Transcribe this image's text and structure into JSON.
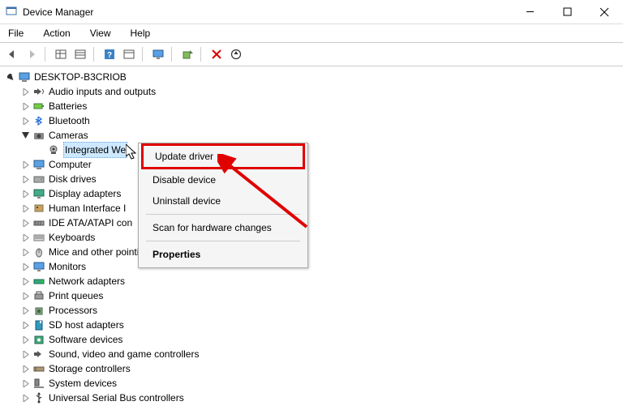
{
  "window": {
    "title": "Device Manager"
  },
  "menu": {
    "file": "File",
    "action": "Action",
    "view": "View",
    "help": "Help"
  },
  "tree": {
    "root": "DESKTOP-B3CRIOB",
    "items": [
      "Audio inputs and outputs",
      "Batteries",
      "Bluetooth",
      "Cameras",
      "Computer",
      "Disk drives",
      "Display adapters",
      "Human Interface I",
      "IDE ATA/ATAPI con",
      "Keyboards",
      "Mice and other pointing devices",
      "Monitors",
      "Network adapters",
      "Print queues",
      "Processors",
      "SD host adapters",
      "Software devices",
      "Sound, video and game controllers",
      "Storage controllers",
      "System devices",
      "Universal Serial Bus controllers"
    ],
    "camera_child": "Integrated We"
  },
  "contextMenu": {
    "updateDriver": "Update driver",
    "disableDevice": "Disable device",
    "uninstallDevice": "Uninstall device",
    "scanHardware": "Scan for hardware changes",
    "properties": "Properties"
  }
}
